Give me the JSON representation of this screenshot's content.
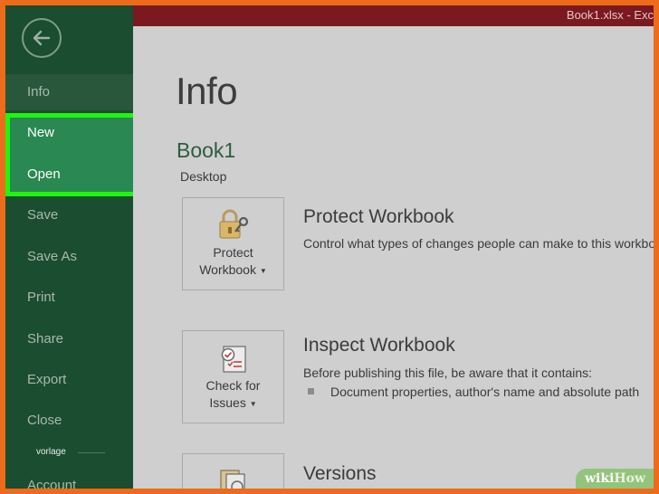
{
  "titlebar": {
    "text": "Book1.xlsx - Exc"
  },
  "sidebar": {
    "items": [
      {
        "label": "Info"
      },
      {
        "label": "New"
      },
      {
        "label": "Open"
      },
      {
        "label": "Save"
      },
      {
        "label": "Save As"
      },
      {
        "label": "Print"
      },
      {
        "label": "Share"
      },
      {
        "label": "Export"
      },
      {
        "label": "Close"
      },
      {
        "label": "Account"
      }
    ],
    "tooltip": "vorlage"
  },
  "main": {
    "title": "Info",
    "book_name": "Book1",
    "book_location": "Desktop",
    "protect": {
      "tile_line1": "Protect",
      "tile_line2": "Workbook",
      "title": "Protect Workbook",
      "desc": "Control what types of changes people can make to this workbo"
    },
    "inspect": {
      "tile_line1": "Check for",
      "tile_line2": "Issues",
      "title": "Inspect Workbook",
      "desc": "Before publishing this file, be aware that it contains:",
      "bullet": "Document properties, author's name and absolute path"
    },
    "versions": {
      "title": "Versions"
    }
  },
  "watermark": {
    "wiki": "wiki",
    "how": "How"
  },
  "colors": {
    "frame": "#ed6b1a",
    "sidebar": "#1b4d30",
    "highlight_border": "#1ff50f",
    "titlebar": "#7b1920"
  }
}
